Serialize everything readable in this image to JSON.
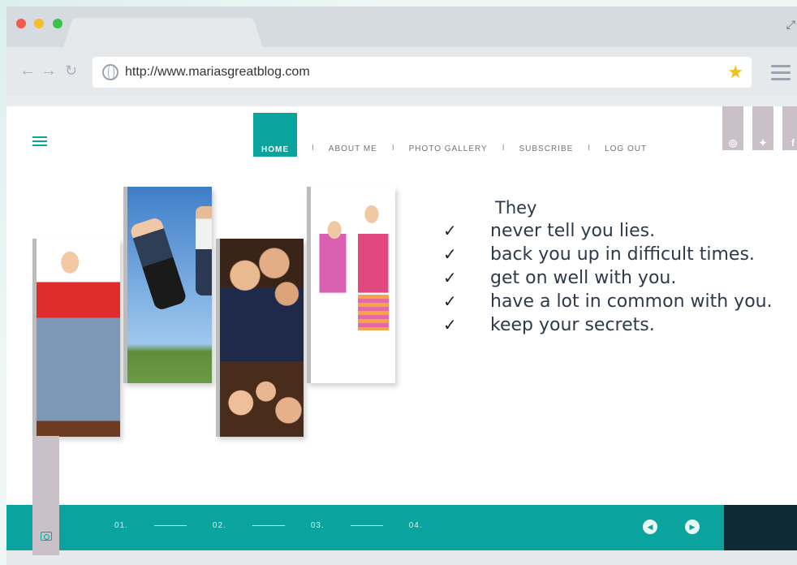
{
  "browser": {
    "url": "http://www.mariasgreatblog.com"
  },
  "nav": {
    "items": [
      "HOME",
      "ABOUT ME",
      "PHOTO GALLERY",
      "SUBSCRIBE",
      "LOG OUT"
    ],
    "separator": "I",
    "active": "HOME"
  },
  "social": [
    "instagram-icon",
    "twitter-icon",
    "facebook-icon"
  ],
  "checklist": {
    "title": "They",
    "items": [
      "never tell you lies.",
      "back you up in difficult times.",
      "get on well with you.",
      "have a lot in common with you.",
      "keep your secrets."
    ],
    "mark": "✓"
  },
  "footer": {
    "steps": [
      "01.",
      "02.",
      "03.",
      "04."
    ]
  },
  "colors": {
    "accent": "#0aa39e",
    "dark": "#0e2a34",
    "muted": "#c9c0c8"
  }
}
